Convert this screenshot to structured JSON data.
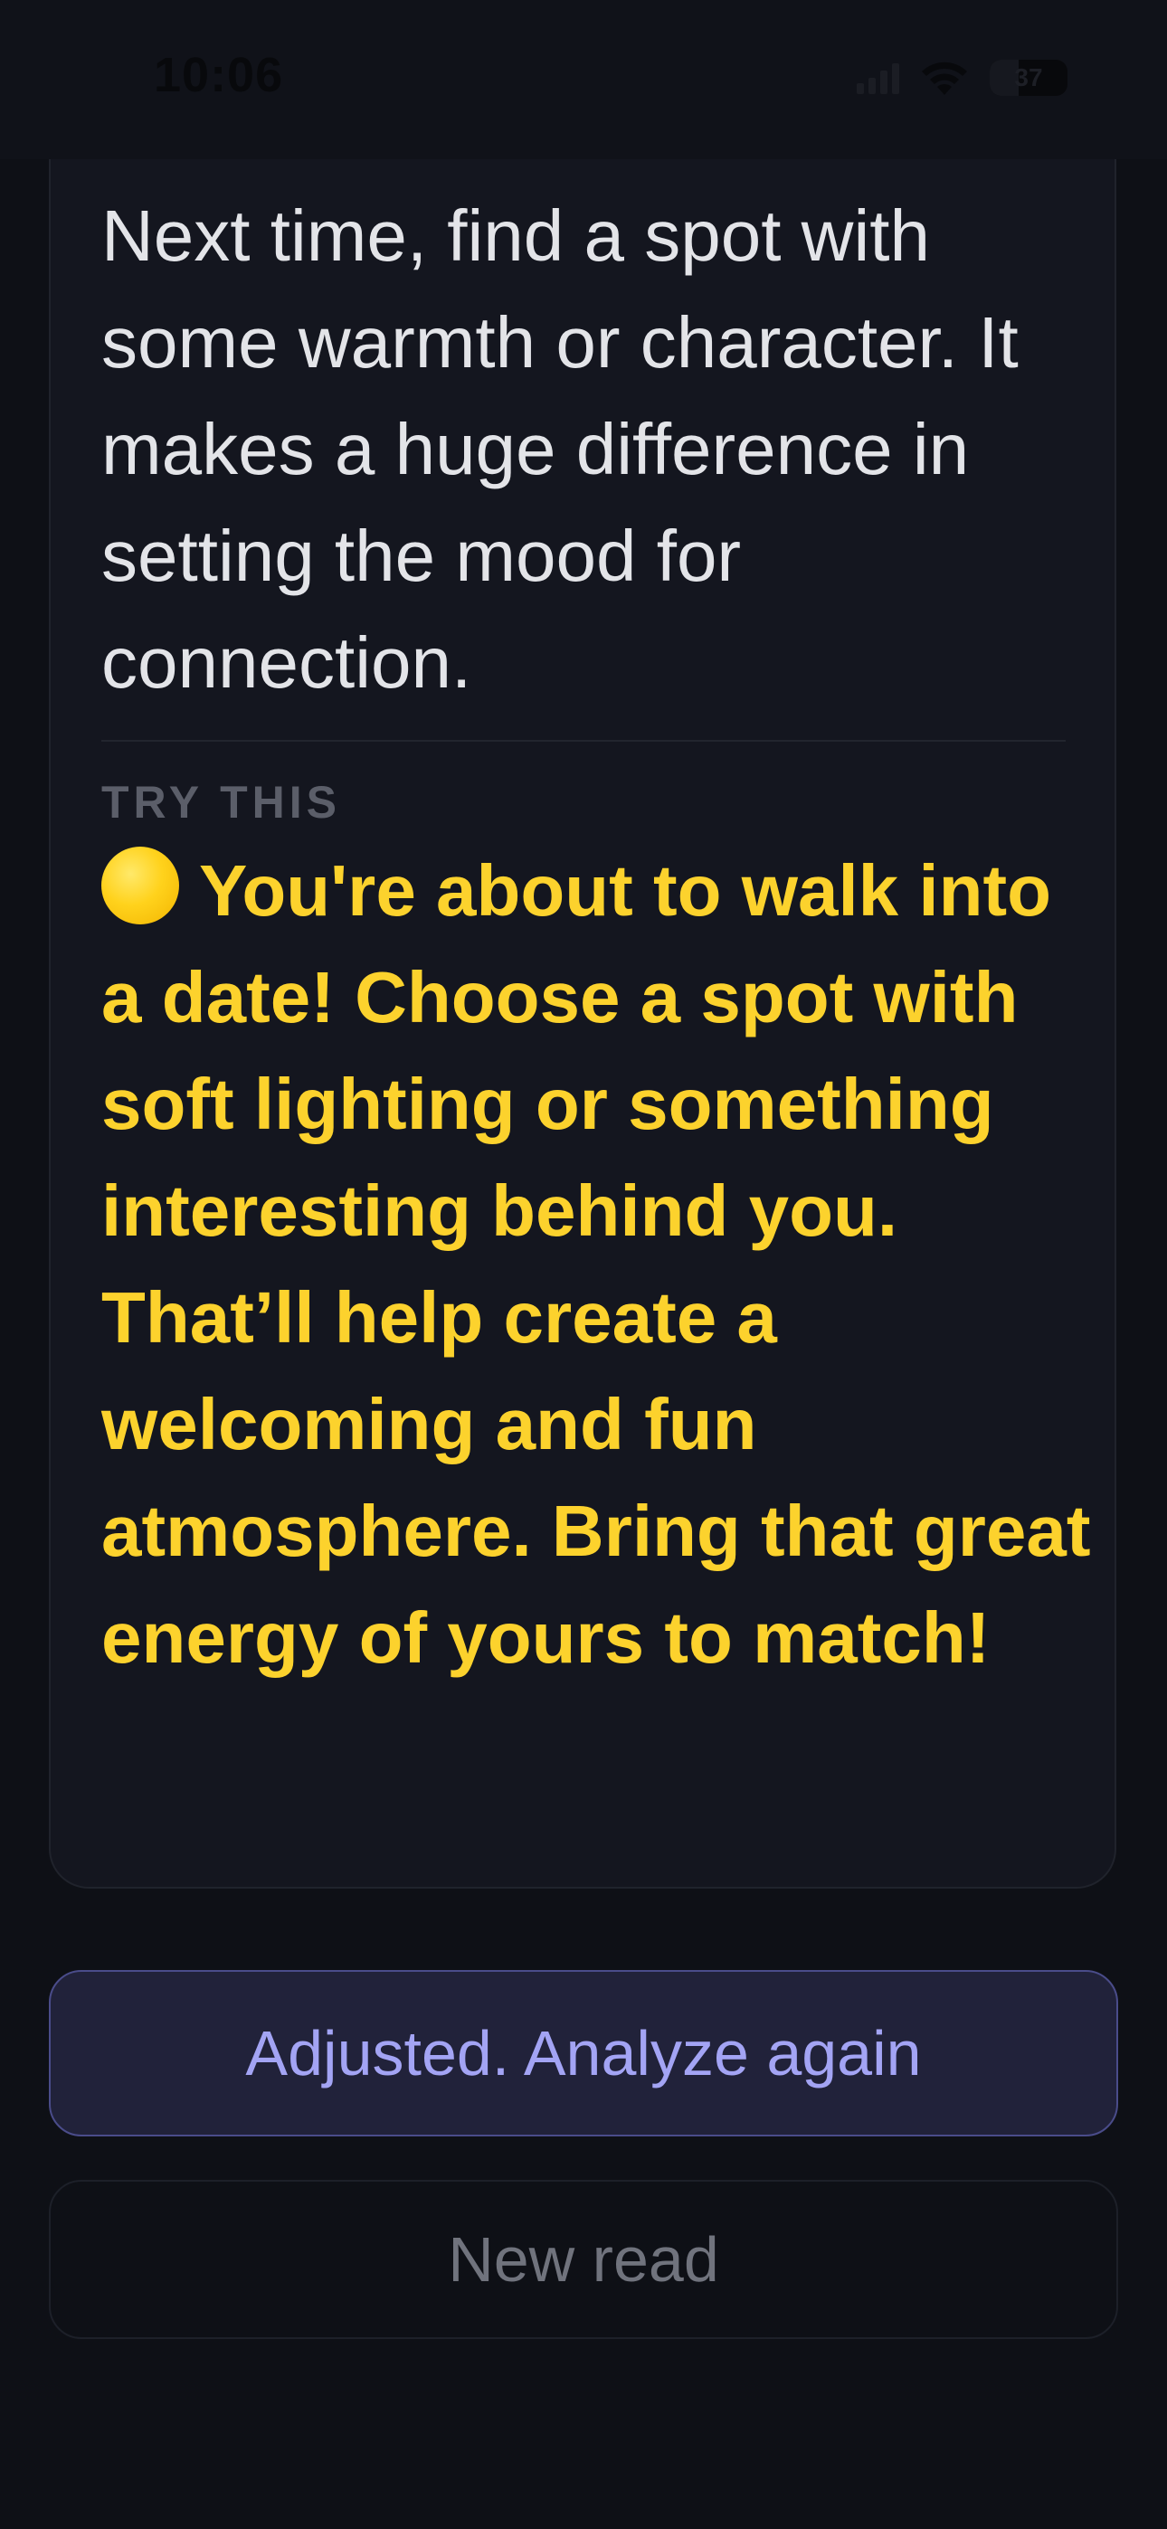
{
  "status_bar": {
    "time": "10:06",
    "battery_level": "37",
    "icons": [
      "cellular-signal-icon",
      "wifi-icon",
      "battery-icon"
    ]
  },
  "card": {
    "body_text": "Next time, find a spot with some warmth or character. It makes a huge difference in setting the mood for connection.",
    "section_label": "TRY THIS",
    "tip_emoji": "yellow-circle-emoji",
    "tip_text": "You're about to walk into a date! Choose a spot with soft lighting or something interesting behind you. That’ll help create a welcoming and fun atmosphere. Bring that great energy of yours to match!"
  },
  "actions": {
    "primary_label": "Adjusted. Analyze again",
    "secondary_label": "New read"
  },
  "colors": {
    "background": "#0e1016",
    "card": "#14161f",
    "tip_accent": "#fcd22d",
    "primary_button_text": "#a3a4f4",
    "primary_button_border": "#4a4c8a"
  }
}
